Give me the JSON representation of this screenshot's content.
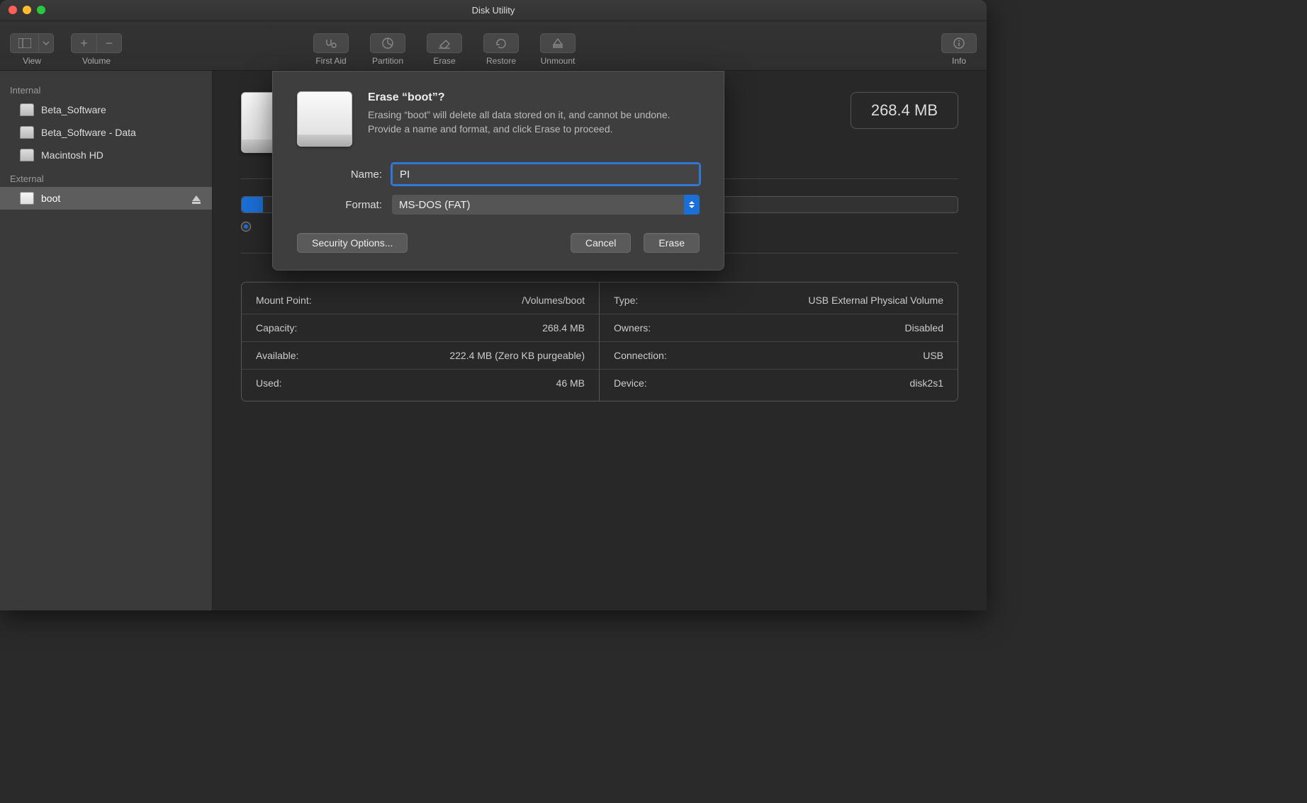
{
  "window": {
    "title": "Disk Utility"
  },
  "toolbar": {
    "view": "View",
    "volume": "Volume",
    "first_aid": "First Aid",
    "partition": "Partition",
    "erase": "Erase",
    "restore": "Restore",
    "unmount": "Unmount",
    "info": "Info"
  },
  "sidebar": {
    "internal_header": "Internal",
    "external_header": "External",
    "internal": [
      {
        "label": "Beta_Software"
      },
      {
        "label": "Beta_Software - Data"
      },
      {
        "label": "Macintosh HD"
      }
    ],
    "external": [
      {
        "label": "boot",
        "selected": true
      }
    ]
  },
  "content": {
    "size_badge": "268.4 MB",
    "info_left": [
      {
        "k": "Mount Point:",
        "v": "/Volumes/boot"
      },
      {
        "k": "Capacity:",
        "v": "268.4 MB"
      },
      {
        "k": "Available:",
        "v": "222.4 MB (Zero KB purgeable)"
      },
      {
        "k": "Used:",
        "v": "46 MB"
      }
    ],
    "info_right": [
      {
        "k": "Type:",
        "v": "USB External Physical Volume"
      },
      {
        "k": "Owners:",
        "v": "Disabled"
      },
      {
        "k": "Connection:",
        "v": "USB"
      },
      {
        "k": "Device:",
        "v": "disk2s1"
      }
    ]
  },
  "dialog": {
    "title": "Erase “boot”?",
    "description": "Erasing “boot” will delete all data stored on it, and cannot be undone. Provide a name and format, and click Erase to proceed.",
    "name_label": "Name:",
    "name_value": "PI",
    "format_label": "Format:",
    "format_value": "MS-DOS (FAT)",
    "security": "Security Options...",
    "cancel": "Cancel",
    "erase": "Erase"
  }
}
